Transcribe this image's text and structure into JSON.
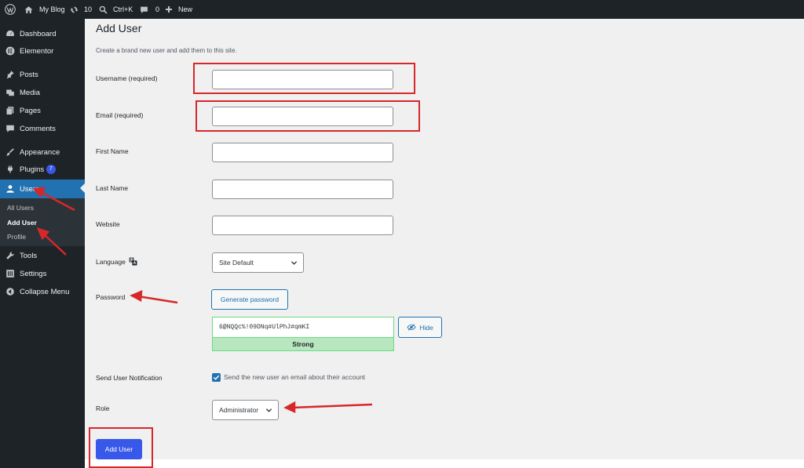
{
  "admin_bar": {
    "site_name": "My Blog",
    "updates_count": "10",
    "search_shortcut": "Ctrl+K",
    "comments_count": "0",
    "new_label": "New"
  },
  "sidebar": {
    "items": [
      {
        "label": "Dashboard",
        "icon": "dashboard-icon"
      },
      {
        "label": "Elementor",
        "icon": "elementor-icon"
      },
      {
        "label": "Posts",
        "icon": "pin-icon"
      },
      {
        "label": "Media",
        "icon": "media-icon"
      },
      {
        "label": "Pages",
        "icon": "pages-icon"
      },
      {
        "label": "Comments",
        "icon": "comment-icon"
      },
      {
        "label": "Appearance",
        "icon": "brush-icon"
      },
      {
        "label": "Plugins",
        "icon": "plug-icon",
        "badge": "7"
      },
      {
        "label": "Users",
        "icon": "user-icon"
      },
      {
        "label": "Tools",
        "icon": "wrench-icon"
      },
      {
        "label": "Settings",
        "icon": "settings-icon"
      },
      {
        "label": "Collapse Menu",
        "icon": "collapse-icon"
      }
    ],
    "submenu": [
      "All Users",
      "Add User",
      "Profile"
    ]
  },
  "page": {
    "title": "Add User",
    "description": "Create a brand new user and add them to this site."
  },
  "form": {
    "username_label": "Username",
    "username_required": "(required)",
    "email_label": "Email",
    "email_required": "(required)",
    "first_name_label": "First Name",
    "last_name_label": "Last Name",
    "website_label": "Website",
    "language_label": "Language",
    "language_value": "Site Default",
    "password_label": "Password",
    "generate_password_label": "Generate password",
    "password_value": "6@NQQc%!09DNq#UlPhJ#qmKI",
    "hide_label": "Hide",
    "strength_label": "Strong",
    "notification_label": "Send User Notification",
    "notification_text": "Send the new user an email about their account",
    "role_label": "Role",
    "role_value": "Administrator",
    "submit_label": "Add User"
  },
  "colors": {
    "admin_bg": "#1d2327",
    "active_menu": "#2271b1",
    "primary_button": "#3858e9",
    "strong_meter": "#b8e6bf",
    "annotation_red": "#d7272a"
  }
}
